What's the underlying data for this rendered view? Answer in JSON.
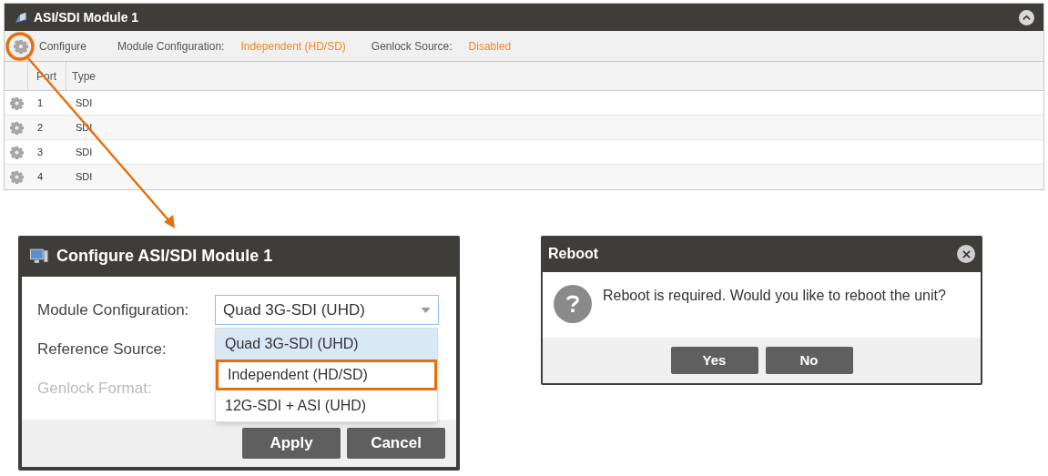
{
  "module_panel": {
    "title": "ASI/SDI Module 1",
    "expanded": true,
    "toolbar": {
      "configure": "Configure",
      "fields": [
        {
          "label": "Module Configuration:",
          "value": "Independent (HD/SD)"
        },
        {
          "label": "Genlock Source:",
          "value": "Disabled"
        }
      ]
    },
    "table": {
      "columns": [
        "Port",
        "Type"
      ],
      "rows": [
        [
          "1",
          "SDI"
        ],
        [
          "2",
          "SDI"
        ],
        [
          "3",
          "SDI"
        ],
        [
          "4",
          "SDI"
        ]
      ]
    }
  },
  "configure_dialog": {
    "title": "Configure ASI/SDI Module 1",
    "fields": [
      {
        "label": "Module Configuration:",
        "value": "Quad 3G-SDI (UHD)",
        "disabled": false,
        "kind": "select"
      },
      {
        "label": "Reference Source:",
        "disabled": false,
        "kind": "label"
      },
      {
        "label": "Genlock Format:",
        "disabled": true,
        "kind": "label"
      }
    ],
    "dropdown_options": [
      {
        "label": "Quad 3G-SDI (UHD)",
        "selected": true,
        "annotated": false
      },
      {
        "label": "Independent (HD/SD)",
        "selected": false,
        "annotated": true
      },
      {
        "label": "12G-SDI + ASI (UHD)",
        "selected": false,
        "annotated": false
      }
    ],
    "buttons": [
      "Apply",
      "Cancel"
    ]
  },
  "reboot_dialog": {
    "title": "Reboot",
    "message": "Reboot is required. Would you like to reboot the unit?",
    "buttons": [
      "Yes",
      "No"
    ]
  }
}
